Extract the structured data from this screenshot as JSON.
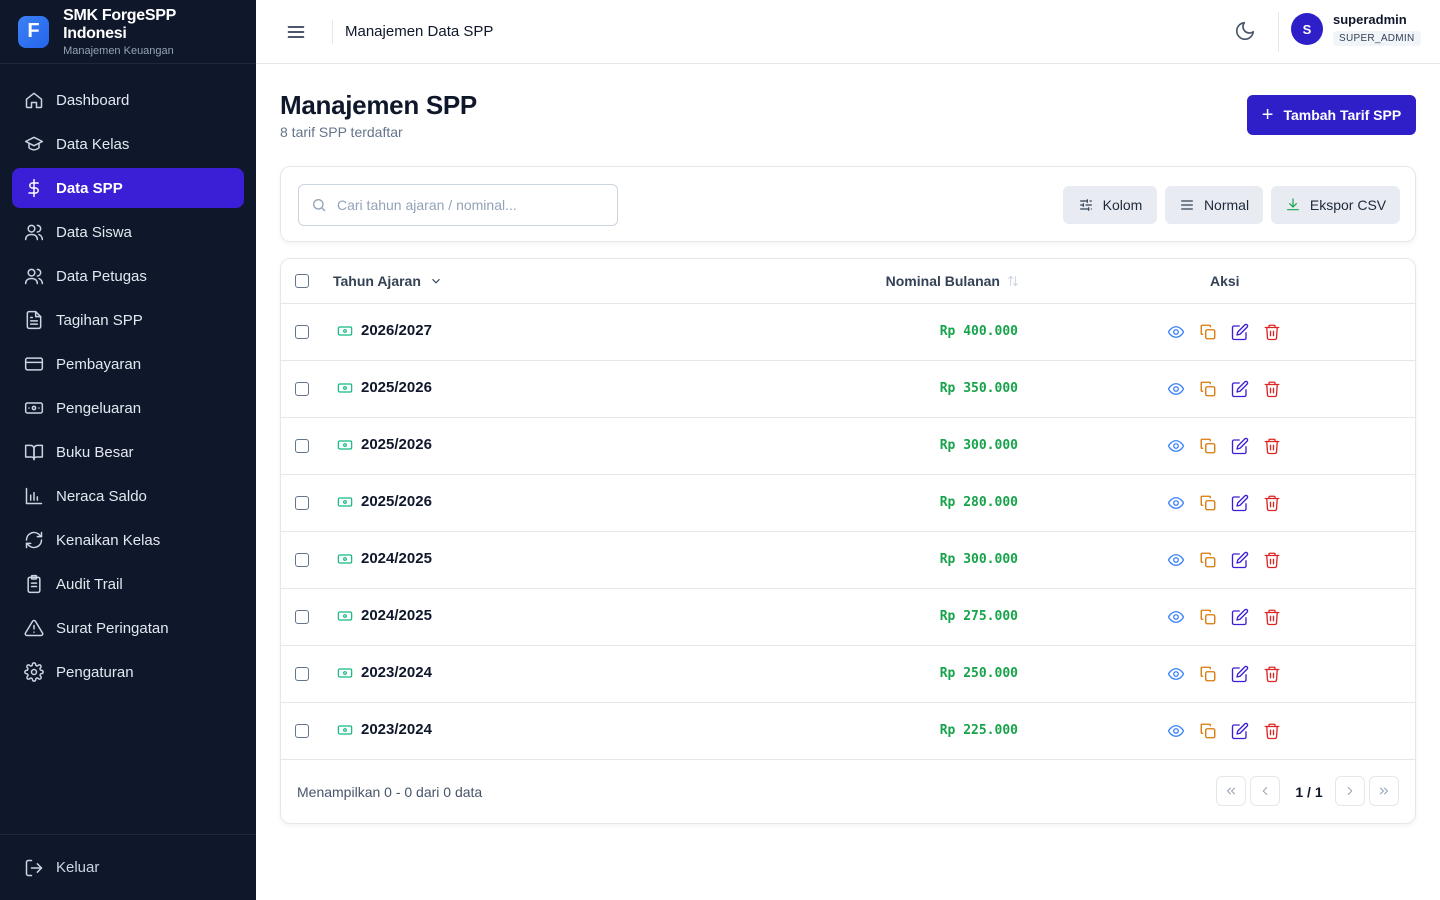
{
  "brand": {
    "name": "SMK ForgeSPP Indonesi",
    "subtitle": "Manajemen Keuangan",
    "logo_letter": "F"
  },
  "sidebar": {
    "items": [
      {
        "label": "Dashboard",
        "icon": "home-icon",
        "active": false
      },
      {
        "label": "Data Kelas",
        "icon": "graduation-cap-icon",
        "active": false
      },
      {
        "label": "Data SPP",
        "icon": "dollar-icon",
        "active": true
      },
      {
        "label": "Data Siswa",
        "icon": "users-icon",
        "active": false
      },
      {
        "label": "Data Petugas",
        "icon": "users-icon",
        "active": false
      },
      {
        "label": "Tagihan SPP",
        "icon": "document-icon",
        "active": false
      },
      {
        "label": "Pembayaran",
        "icon": "credit-card-icon",
        "active": false
      },
      {
        "label": "Pengeluaran",
        "icon": "banknote-icon",
        "active": false
      },
      {
        "label": "Buku Besar",
        "icon": "book-icon",
        "active": false
      },
      {
        "label": "Neraca Saldo",
        "icon": "bar-chart-icon",
        "active": false
      },
      {
        "label": "Kenaikan Kelas",
        "icon": "refresh-icon",
        "active": false
      },
      {
        "label": "Audit Trail",
        "icon": "clipboard-icon",
        "active": false
      },
      {
        "label": "Surat Peringatan",
        "icon": "warning-icon",
        "active": false
      },
      {
        "label": "Pengaturan",
        "icon": "gear-icon",
        "active": false
      }
    ],
    "logout_label": "Keluar"
  },
  "topbar": {
    "title": "Manajemen Data SPP",
    "user": {
      "name": "superadmin",
      "role": "SUPER_ADMIN",
      "initial": "S"
    }
  },
  "page": {
    "title": "Manajemen SPP",
    "subtitle": "8 tarif SPP terdaftar",
    "add_button": "Tambah Tarif SPP"
  },
  "toolbar": {
    "search_placeholder": "Cari tahun ajaran / nominal...",
    "kolom": "Kolom",
    "density": "Normal",
    "export": "Ekspor CSV"
  },
  "table": {
    "headers": {
      "tahun": "Tahun Ajaran",
      "nominal": "Nominal Bulanan",
      "aksi": "Aksi"
    },
    "rows": [
      {
        "tahun": "2026/2027",
        "nominal": "Rp 400.000"
      },
      {
        "tahun": "2025/2026",
        "nominal": "Rp 350.000"
      },
      {
        "tahun": "2025/2026",
        "nominal": "Rp 300.000"
      },
      {
        "tahun": "2025/2026",
        "nominal": "Rp 280.000"
      },
      {
        "tahun": "2024/2025",
        "nominal": "Rp 300.000"
      },
      {
        "tahun": "2024/2025",
        "nominal": "Rp 275.000"
      },
      {
        "tahun": "2023/2024",
        "nominal": "Rp 250.000"
      },
      {
        "tahun": "2023/2024",
        "nominal": "Rp 225.000"
      }
    ],
    "footer_info": "Menampilkan 0 - 0 dari 0 data",
    "pagination": "1 / 1"
  },
  "colors": {
    "accent": "#2e1fc9",
    "sidebar_bg": "#0f172a",
    "money": "#16a34a"
  }
}
